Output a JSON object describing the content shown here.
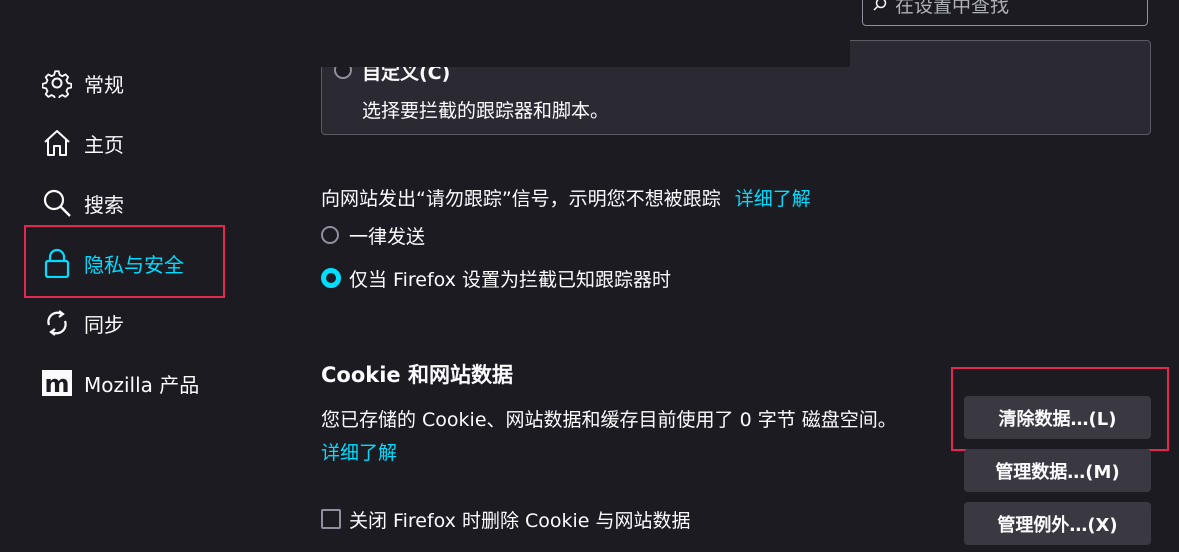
{
  "search": {
    "placeholder": "在设置中查找"
  },
  "sidebar": {
    "items": [
      {
        "label": "常规",
        "icon": "gear-icon"
      },
      {
        "label": "主页",
        "icon": "home-icon"
      },
      {
        "label": "搜索",
        "icon": "search-icon"
      },
      {
        "label": "隐私与安全",
        "icon": "lock-icon",
        "active": true
      },
      {
        "label": "同步",
        "icon": "sync-icon"
      },
      {
        "label": "Mozilla 产品",
        "icon": "mozilla-logo-icon"
      }
    ]
  },
  "custom_tracking": {
    "label": "自定义(C)",
    "description": "选择要拦截的跟踪器和脚本。"
  },
  "dnt": {
    "description": "向网站发出“请勿跟踪”信号，示明您不想被跟踪",
    "learn_more": "详细了解",
    "options": [
      {
        "label": "一律发送",
        "checked": false
      },
      {
        "label": "仅当 Firefox 设置为拦截已知跟踪器时",
        "checked": true
      }
    ]
  },
  "cookies": {
    "title": "Cookie 和网站数据",
    "usage_text": "您已存储的 Cookie、网站数据和缓存目前使用了 0 字节 磁盘空间。",
    "learn_more": "详细了解",
    "clear_button": "清除数据…(L)",
    "manage_button": "管理数据…(M)",
    "exceptions_button": "管理例外…(X)",
    "delete_on_close_label": "关闭 Firefox 时删除 Cookie 与网站数据"
  },
  "colors": {
    "background": "#1c1b22",
    "accent": "#00ddff",
    "highlight": "#e22850",
    "button": "#3a3942"
  }
}
